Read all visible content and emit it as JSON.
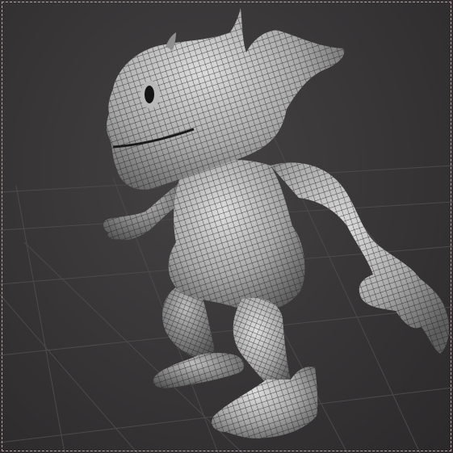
{
  "viewport": {
    "view": "3d-viewport",
    "shading": "wireframe-on-shaded",
    "grid": true,
    "colors": {
      "background": "#393738",
      "grid": "#4d4a4c",
      "border": "#b7a5a7",
      "mesh_light": "#cfcfcf",
      "mesh_dark": "#5a5a5a",
      "wire": "#1c1c1c"
    },
    "model": "creature-character-mesh"
  }
}
